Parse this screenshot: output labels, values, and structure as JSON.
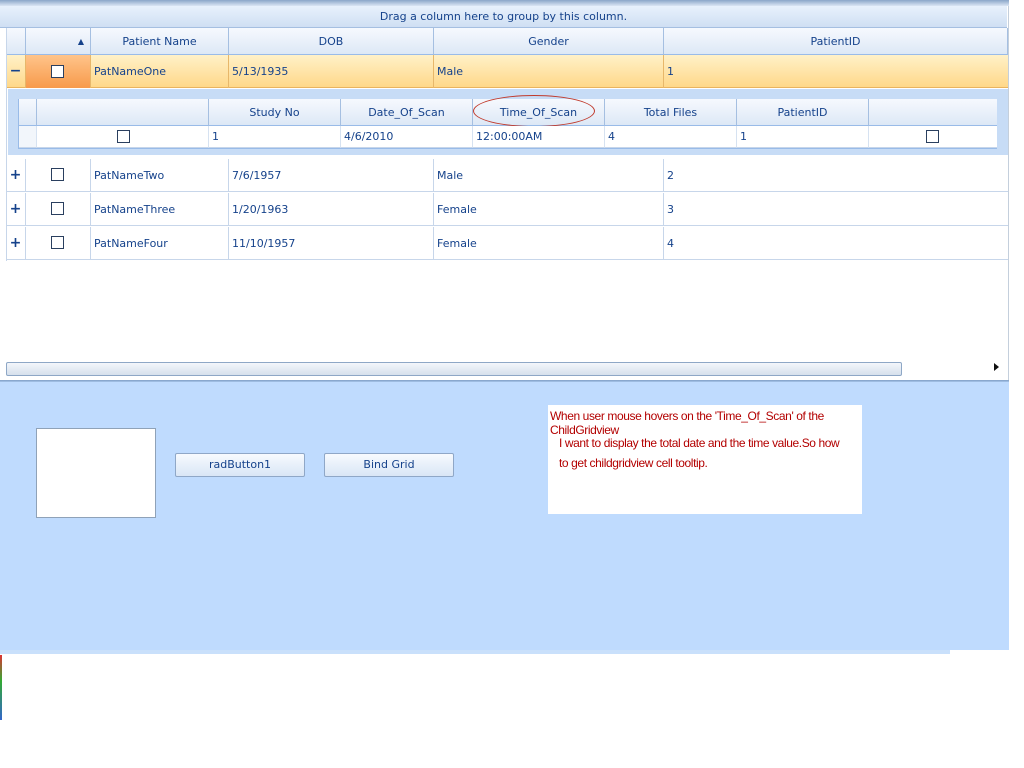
{
  "grid": {
    "group_panel_text": "Drag a column here to group by this column.",
    "columns": [
      "Patient Name",
      "DOB",
      "Gender",
      "PatientID"
    ],
    "rows": [
      {
        "expander": "−",
        "name": "PatNameOne",
        "dob": "5/13/1935",
        "gender": "Male",
        "id": "1"
      },
      {
        "expander": "+",
        "name": "PatNameTwo",
        "dob": "7/6/1957",
        "gender": "Male",
        "id": "2"
      },
      {
        "expander": "+",
        "name": "PatNameThree",
        "dob": "1/20/1963",
        "gender": "Female",
        "id": "3"
      },
      {
        "expander": "+",
        "name": "PatNameFour",
        "dob": "11/10/1957",
        "gender": "Female",
        "id": "4"
      }
    ],
    "child": {
      "columns": [
        "Study No",
        "Date_Of_Scan",
        "Time_Of_Scan",
        "Total Files",
        "PatientID"
      ],
      "row": {
        "study_no": "1",
        "date_of_scan": "4/6/2010",
        "time_of_scan": "12:00:00AM",
        "total_files": "4",
        "patient_id": "1"
      }
    }
  },
  "panel": {
    "button1": "radButton1",
    "button2": "Bind Grid",
    "note_line1": "When user mouse hovers on the 'Time_Of_Scan' of the ChildGridview",
    "note_line2": "I want to display the total date and the time value.So how to get childgridview cell tooltip."
  },
  "colors": {
    "accent": "#15428b",
    "selected_row": "#ffd889",
    "panel_bg": "#bfdbfe",
    "note_text": "#b30000"
  }
}
